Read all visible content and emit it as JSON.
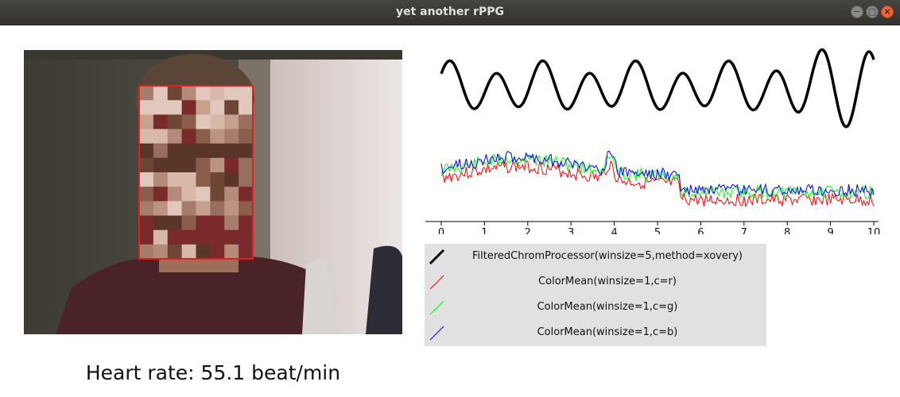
{
  "window": {
    "title": "yet another rPPG",
    "buttons": {
      "minimize": "−",
      "maximize": "□",
      "close": "×"
    }
  },
  "heart_rate": {
    "text": "Heart rate: 55.1 beat/min"
  },
  "plot": {
    "x_ticks": [
      "0",
      "1",
      "2",
      "3",
      "4",
      "5",
      "6",
      "7",
      "8",
      "9",
      "10"
    ],
    "xlim": [
      0,
      10
    ]
  },
  "legend": {
    "items": [
      {
        "label": "FilteredChromProcessor(winsize=5,method=xovery)",
        "color": "#000000"
      },
      {
        "label": "ColorMean(winsize=1,c=r)",
        "color": "#ff0000"
      },
      {
        "label": "ColorMean(winsize=1,c=g)",
        "color": "#00ff00"
      },
      {
        "label": "ColorMean(winsize=1,c=b)",
        "color": "#0000ff"
      }
    ]
  },
  "colors": {
    "face_box": "#e02020",
    "titlebar": "#3c3b37",
    "legend_bg": "#e1e1e1"
  }
}
